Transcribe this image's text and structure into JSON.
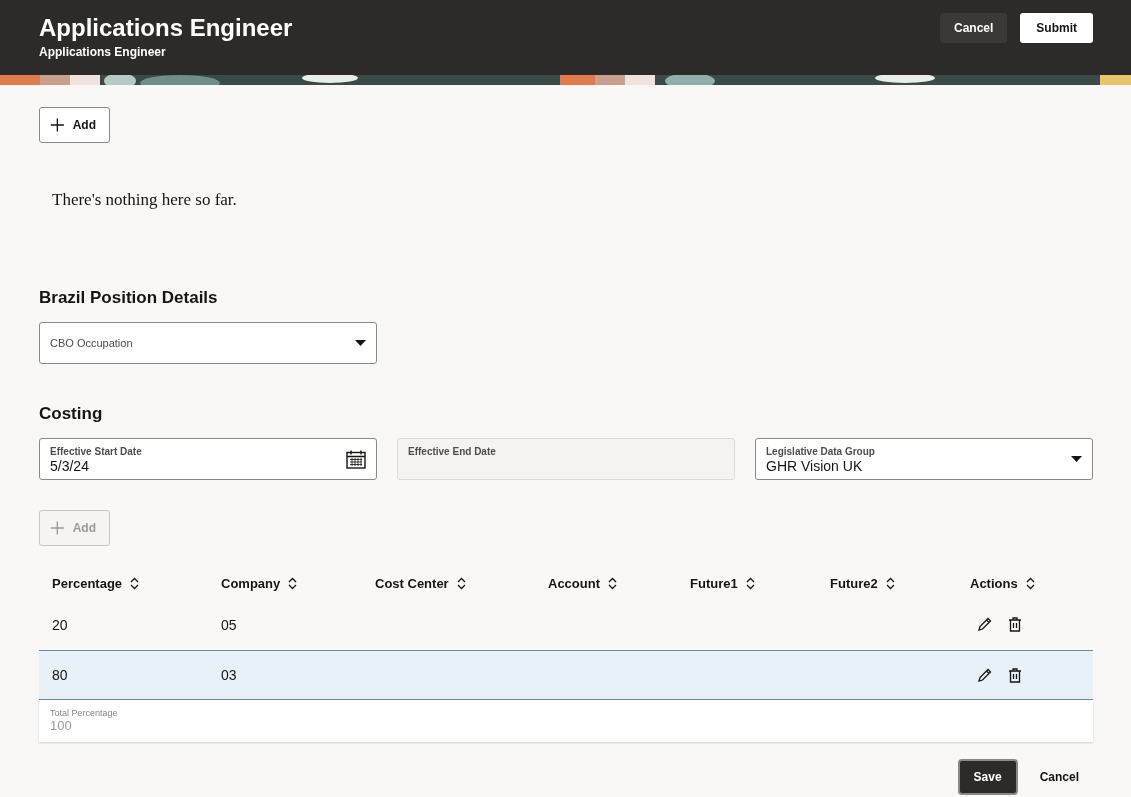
{
  "header": {
    "title": "Applications Engineer",
    "subtitle": "Applications Engineer",
    "buttons": [
      {
        "label": "Cancel",
        "kind": "secondary"
      },
      {
        "label": "Submit",
        "kind": "primary"
      }
    ]
  },
  "attachments": {
    "add_button": {
      "label": "Add",
      "disabled": false
    },
    "empty_message": "There's nothing here so far."
  },
  "brazil_position_details": {
    "heading": "Brazil Position Details",
    "fields": [
      {
        "label": "CBO Occupation",
        "kind": "select"
      }
    ]
  },
  "costing": {
    "heading": "Costing",
    "fields": [
      {
        "label": "Effective Start Date",
        "value": "5/3/24",
        "kind": "date",
        "disabled": false
      },
      {
        "label": "Effective End Date",
        "kind": "text",
        "disabled": true
      },
      {
        "label": "Legislative Data Group",
        "value": "GHR Vision UK",
        "kind": "select",
        "disabled": false
      }
    ],
    "add_button": {
      "label": "Add",
      "disabled": true
    },
    "table": {
      "columns": [
        "Percentage",
        "Company",
        "Cost Center",
        "Account",
        "Future1",
        "Future2",
        "Actions"
      ],
      "rows": [
        {
          "cells": [
            "20",
            "05",
            "",
            "",
            "",
            "",
            ""
          ],
          "selected": false
        },
        {
          "cells": [
            "80",
            "03",
            "",
            "",
            "",
            "",
            ""
          ],
          "selected": true
        }
      ],
      "total": {
        "label": "Total Percentage",
        "value": "100"
      }
    }
  },
  "footer": {
    "buttons": [
      {
        "label": "Save",
        "kind": "primary"
      },
      {
        "label": "Cancel",
        "kind": "secondary"
      }
    ]
  }
}
